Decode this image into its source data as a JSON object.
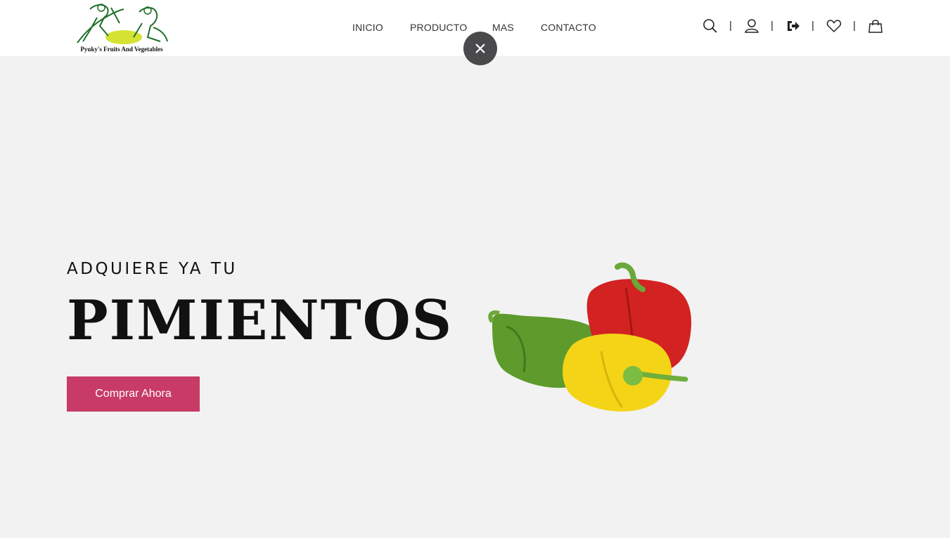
{
  "brand": {
    "logo_text": "Pyuky's Fruits And Vegetables"
  },
  "nav": {
    "items": [
      {
        "label": "INICIO"
      },
      {
        "label": "PRODUCTO"
      },
      {
        "label": "MAS"
      },
      {
        "label": "CONTACTO"
      }
    ]
  },
  "header_icons": [
    "search-icon",
    "user-icon",
    "logout-icon",
    "heart-icon",
    "shopping-bag-icon"
  ],
  "separator": "|",
  "hero": {
    "subtitle": "ADQUIERE YA TU",
    "title": "PIMIENTOS",
    "cta_label": "Comprar Ahora"
  },
  "colors": {
    "accent": "#c73b66",
    "background": "#f2f2f2",
    "close_button": "#4a4a4c"
  }
}
